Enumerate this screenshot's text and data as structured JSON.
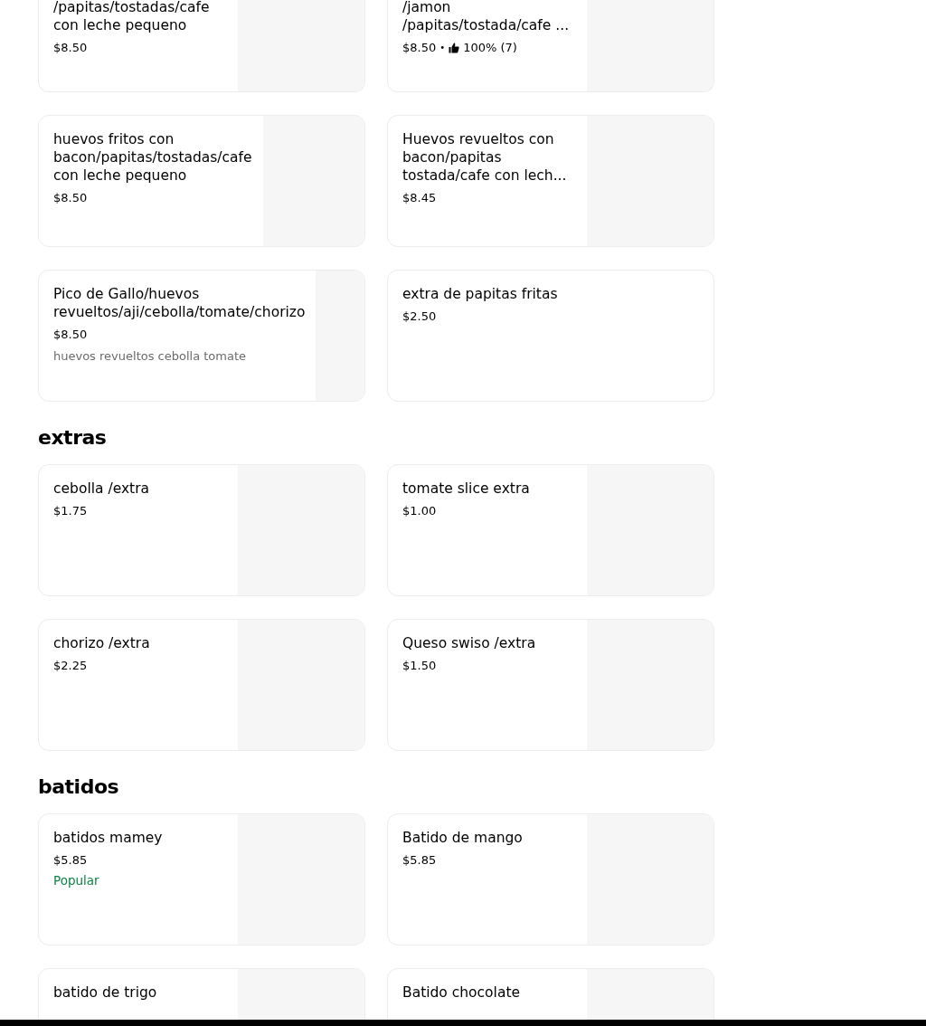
{
  "sections": [
    {
      "items": [
        {
          "title": "/papitas/tostadas/cafe con leche pequeno",
          "price": "$8.50",
          "image": true
        },
        {
          "title": "/jamon /papitas/tostada/cafe ...",
          "price": "$8.50",
          "separator": "•",
          "rating": "100% (7)",
          "image": true
        },
        {
          "title": "huevos fritos con bacon/papitas/tostadas/cafe con leche pequeno",
          "price": "$8.50",
          "image": true
        },
        {
          "title": "Huevos revueltos con bacon/papitas tostada/cafe con lech...",
          "price": "$8.45",
          "image": true
        },
        {
          "title": "Pico de Gallo/huevos revueltos/aji/cebolla/tomate/chorizo",
          "price": "$8.50",
          "description": "huevos revueltos cebolla tomate",
          "image": true
        },
        {
          "title": "extra de papitas fritas",
          "price": "$2.50",
          "image": false
        }
      ]
    },
    {
      "title": "extras",
      "items": [
        {
          "title": "cebolla /extra",
          "price": "$1.75",
          "image": true
        },
        {
          "title": "tomate slice extra",
          "price": "$1.00",
          "image": true
        },
        {
          "title": "chorizo /extra",
          "price": "$2.25",
          "image": true
        },
        {
          "title": "Queso swiso /extra",
          "price": "$1.50",
          "image": true
        }
      ]
    },
    {
      "title": "batidos",
      "items": [
        {
          "title": "batidos mamey",
          "price": "$5.85",
          "badge": "Popular",
          "image": true
        },
        {
          "title": "Batido de mango",
          "price": "$5.85",
          "image": true
        },
        {
          "title": "batido de trigo",
          "image": true
        },
        {
          "title": "Batido chocolate",
          "image": true
        }
      ]
    }
  ]
}
